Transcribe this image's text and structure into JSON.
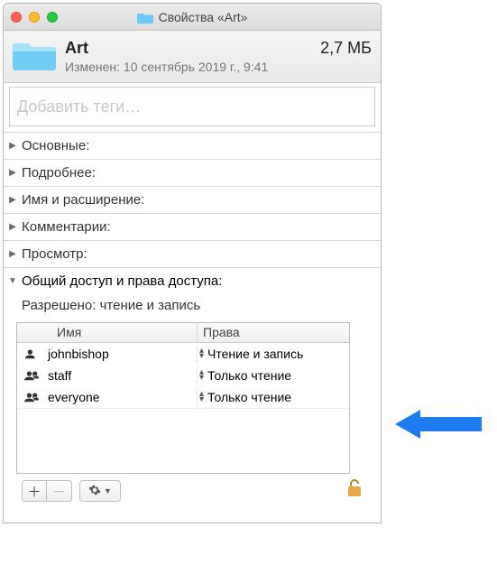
{
  "window": {
    "title": "Свойства «Art»"
  },
  "header": {
    "name": "Art",
    "size": "2,7 МБ",
    "modified": "Изменен: 10 сентябрь 2019 г., 9:41"
  },
  "tags": {
    "placeholder": "Добавить теги…"
  },
  "sections": {
    "general": "Основные:",
    "more": "Подробнее:",
    "name_ext": "Имя и расширение:",
    "comments": "Комментарии:",
    "preview": "Просмотр:",
    "sharing": "Общий доступ и права доступа:"
  },
  "sharing": {
    "allowed": "Разрешено: чтение и запись",
    "col_name": "Имя",
    "col_priv": "Права",
    "rows": [
      {
        "name": "johnbishop",
        "priv": "Чтение и запись",
        "icon": "user"
      },
      {
        "name": "staff",
        "priv": "Только чтение",
        "icon": "group"
      },
      {
        "name": "everyone",
        "priv": "Только чтение",
        "icon": "group"
      }
    ]
  },
  "buttons": {
    "add": "＋",
    "remove": "－"
  }
}
